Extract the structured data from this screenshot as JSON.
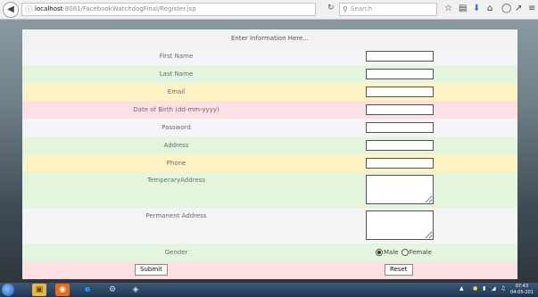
{
  "browser": {
    "url_host": "localhost",
    "url_rest": ":8081/FacebookWatchdogFinal/Register.jsp",
    "search_placeholder": "Search"
  },
  "form": {
    "header": "Enter Information Here...",
    "fields": {
      "first_name": "First Name",
      "last_name": "Last Name",
      "email": "Email",
      "dob": "Date of Birth (dd-mm-yyyy)",
      "password": "Password",
      "address": "Address",
      "phone": "Phone",
      "temporary_address": "TemperaryAddress",
      "permanent_address": "Permanent Address",
      "gender": "Gender"
    },
    "gender_options": {
      "male": "Male",
      "female": "Female",
      "selected": "Male"
    },
    "submit_label": "Submit",
    "reset_label": "Reset"
  },
  "taskbar": {
    "time": "07:43",
    "date": "04-05-201"
  }
}
